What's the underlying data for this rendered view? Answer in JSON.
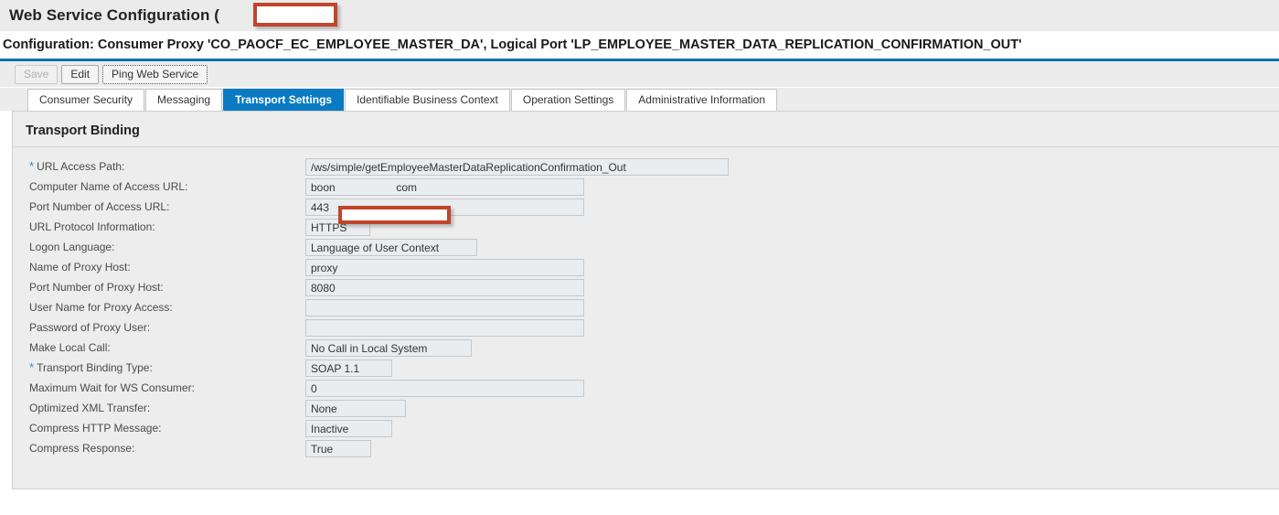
{
  "header": {
    "title": "Web Service Configuration (",
    "redaction_label": "redacted-system-id"
  },
  "subtitle": {
    "text": "Configuration: Consumer Proxy 'CO_PAOCF_EC_EMPLOYEE_MASTER_DA', Logical Port 'LP_EMPLOYEE_MASTER_DATA_REPLICATION_CONFIRMATION_OUT'"
  },
  "toolbar": {
    "save_label": "Save",
    "edit_label": "Edit",
    "ping_label": "Ping Web Service"
  },
  "tabs": [
    {
      "label": "Consumer Security",
      "active": false
    },
    {
      "label": "Messaging",
      "active": false
    },
    {
      "label": "Transport Settings",
      "active": true
    },
    {
      "label": "Identifiable Business Context",
      "active": false
    },
    {
      "label": "Operation Settings",
      "active": false
    },
    {
      "label": "Administrative Information",
      "active": false
    }
  ],
  "panel": {
    "title": "Transport Binding"
  },
  "fields": [
    {
      "label": "URL Access Path:",
      "value": "/ws/simple/getEmployeeMasterDataReplicationConfirmation_Out",
      "required": true
    },
    {
      "label": "Computer Name of Access URL:",
      "value": "boon",
      "value_suffix": "com",
      "required": false,
      "redacted": true
    },
    {
      "label": "Port Number of Access URL:",
      "value": "443",
      "required": false
    },
    {
      "label": "URL Protocol Information:",
      "value": "HTTPS",
      "required": false
    },
    {
      "label": "Logon Language:",
      "value": "Language of User Context",
      "required": false
    },
    {
      "label": "Name of Proxy Host:",
      "value": "proxy",
      "required": false
    },
    {
      "label": "Port Number of Proxy Host:",
      "value": "8080",
      "required": false
    },
    {
      "label": "User Name for Proxy Access:",
      "value": "",
      "required": false
    },
    {
      "label": "Password of Proxy User:",
      "value": "",
      "required": false
    },
    {
      "label": "Make Local Call:",
      "value": "No Call in Local System",
      "required": false
    },
    {
      "label": "Transport Binding Type:",
      "value": "SOAP 1.1",
      "required": true
    },
    {
      "label": "Maximum Wait for WS Consumer:",
      "value": "0",
      "required": false
    },
    {
      "label": "Optimized XML Transfer:",
      "value": "None",
      "required": false
    },
    {
      "label": "Compress HTTP Message:",
      "value": "Inactive",
      "required": false
    },
    {
      "label": "Compress Response:",
      "value": "True",
      "required": false
    }
  ],
  "colors": {
    "accent_blue": "#0a7bc2",
    "rule_blue": "#0a72b0",
    "required_star": "#2d8fd5",
    "redaction_border": "#c0452c",
    "field_bg": "#e9edf0",
    "panel_bg": "#ededed"
  }
}
